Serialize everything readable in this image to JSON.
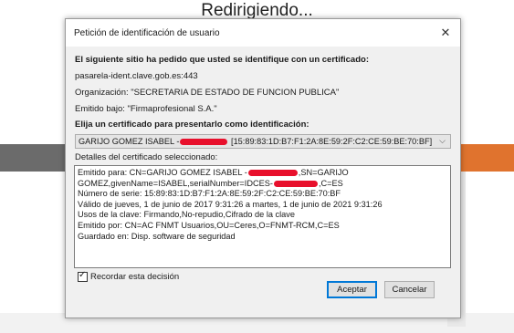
{
  "page": {
    "heading": "Redirigiendo..."
  },
  "dialog": {
    "title": "Petición de identificación de usuario",
    "close_glyph": "✕",
    "intro": "El siguiente sitio ha pedido que usted se identifique con un certificado:",
    "site": "pasarela-ident.clave.gob.es:443",
    "organization": "Organización: \"SECRETARIA DE ESTADO DE FUNCION PUBLICA\"",
    "issued_under": "Emitido bajo: \"Firmaprofesional S.A.\"",
    "choose_label": "Elija un certificado para presentarlo como identificación:",
    "select": {
      "value_prefix": "GARIJO GOMEZ ISABEL -",
      "value_suffix": "[15:89:83:1D:B7:F1:2A:8E:59:2F:C2:CE:59:BE:70:BF]",
      "caret_icon": "chevron-down-icon"
    },
    "details_label": "Detalles del certificado seleccionado:",
    "details": {
      "line1_prefix": "Emitido para: CN=GARIJO GOMEZ ISABEL -",
      "line1_suffix": ",SN=GARIJO",
      "line2_prefix": "GOMEZ,givenName=ISABEL,serialNumber=IDCES-",
      "line2_suffix": ",C=ES",
      "line3": "Número de serie: 15:89:83:1D:B7:F1:2A:8E:59:2F:C2:CE:59:BE:70:BF",
      "line4": "Válido de jueves, 1 de junio de 2017 9:31:26 a martes, 1 de junio de 2021 9:31:26",
      "line5": "Usos de la clave: Firmando,No-repudio,Cifrado de la clave",
      "line6": "Emitido por: CN=AC FNMT Usuarios,OU=Ceres,O=FNMT-RCM,C=ES",
      "line7": "Guardado en: Disp. software de seguridad"
    },
    "remember": {
      "label": "Recordar esta decisión",
      "checked": true
    },
    "buttons": {
      "accept": "Aceptar",
      "cancel": "Cancelar"
    }
  },
  "colors": {
    "redaction": "#e8102c",
    "focus_border": "#0078d7",
    "backdrop_orange": "#e0732e"
  }
}
